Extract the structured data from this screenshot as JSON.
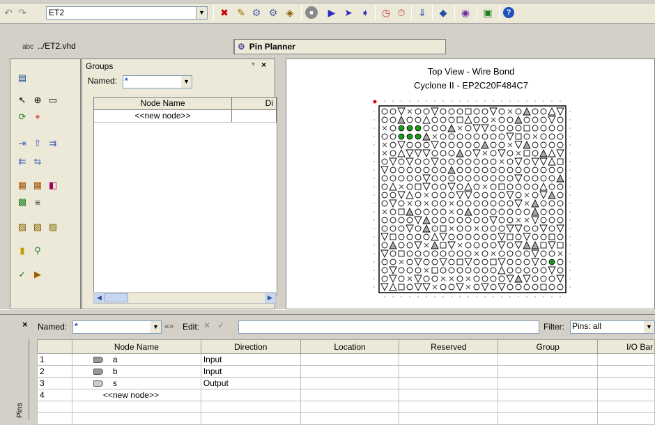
{
  "toolbar": {
    "project": "ET2",
    "icons": [
      "undo-icon",
      "redo-icon",
      "stop-icon",
      "start-compilation-icon",
      "timing-icon",
      "help-icon"
    ]
  },
  "tabs": [
    {
      "label": "../ET2.vhd"
    },
    {
      "label": "Pin Planner"
    }
  ],
  "groups": {
    "title": "Groups",
    "named_label": "Named:",
    "named_value": "*",
    "columns": [
      "Node Name",
      "Di"
    ],
    "rows": [
      [
        "<<new node>>",
        ""
      ]
    ]
  },
  "view": {
    "title": "Top View - Wire Bond",
    "subtitle": "Cyclone II - EP2C20F484C7"
  },
  "pins": {
    "named_label": "Named:",
    "named_value": "*",
    "edit_label": "Edit:",
    "filter_label": "Filter:",
    "filter_value": "Pins: all",
    "side_label": "Pins",
    "columns": [
      "",
      "Node Name",
      "Direction",
      "Location",
      "Reserved",
      "Group",
      "I/O Bar"
    ],
    "rows": [
      {
        "num": "1",
        "name": "a",
        "direction": "Input",
        "type": "in"
      },
      {
        "num": "2",
        "name": "b",
        "direction": "Input",
        "type": "in"
      },
      {
        "num": "3",
        "name": "s",
        "direction": "Output",
        "type": "out"
      },
      {
        "num": "4",
        "name": "<<new node>>",
        "direction": "",
        "type": ""
      }
    ]
  }
}
